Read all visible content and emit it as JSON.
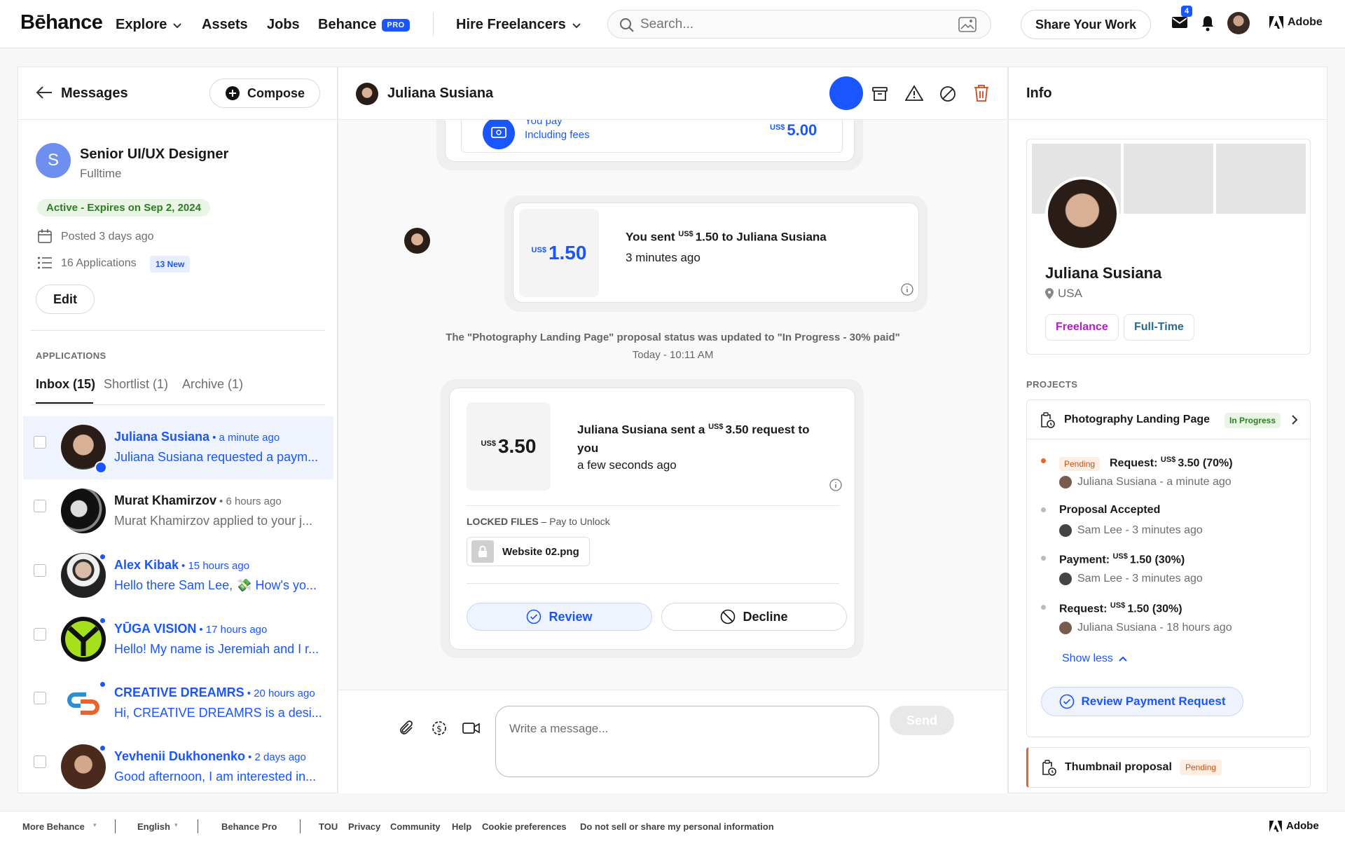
{
  "nav": {
    "logo": "Bēhance",
    "explore": "Explore",
    "assets": "Assets",
    "jobs": "Jobs",
    "behance": "Behance",
    "pro": "PRO",
    "hire": "Hire Freelancers",
    "search_placeholder": "Search...",
    "share": "Share Your Work",
    "mail_count": "4",
    "adobe": "Adobe"
  },
  "left": {
    "title": "Messages",
    "compose": "Compose",
    "job": {
      "initial": "S",
      "title": "Senior UI/UX Designer",
      "type": "Fulltime",
      "status": "Active - Expires on Sep 2, 2024",
      "posted": "Posted 3 days ago",
      "applications": "16 Applications",
      "new_badge": "13 New",
      "edit": "Edit"
    },
    "applications_label": "APPLICATIONS",
    "tabs": [
      "Inbox (15)",
      "Shortlist (1)",
      "Archive (1)"
    ],
    "conversations": [
      {
        "name": "Juliana Susiana",
        "time": "• a minute ago",
        "preview": "Juliana Susiana requested a paym...",
        "unread": true
      },
      {
        "name": "Murat Khamirzov",
        "time": "• 6 hours ago",
        "preview": "Murat Khamirzov applied to your j...",
        "unread": false
      },
      {
        "name": "Alex Kibak",
        "time": "• 15 hours ago",
        "preview": "Hello there Sam Lee, 💸 How's yo...",
        "unread": true
      },
      {
        "name": "YŪGA VISION",
        "time": "• 17 hours ago",
        "preview": "Hello! My name is Jeremiah and I r...",
        "unread": true
      },
      {
        "name": "CREATIVE DREAMRS",
        "time": "• 20 hours ago",
        "preview": "Hi, CREATIVE DREAMRS is a desi...",
        "unread": true
      },
      {
        "name": "Yevhenii Dukhonenko",
        "time": "• 2 days ago",
        "preview": "Good afternoon, I am interested in...",
        "unread": true
      }
    ]
  },
  "chat": {
    "name": "Juliana Susiana",
    "top_card": {
      "pay_label": "You pay",
      "fees": "Including fees",
      "currency": "US$",
      "amount": "5.00"
    },
    "sent_card": {
      "currency": "US$",
      "amount": "1.50",
      "line_pre": "You sent ",
      "line_amount": "1.50",
      "line_post": " to Juliana Susiana",
      "time": "3 minutes ago"
    },
    "status_msg": "The \"Photography Landing Page\" proposal status was updated to \"In Progress - 30% paid\"",
    "status_time": "Today - 10:11 AM",
    "request_card": {
      "currency": "US$",
      "amount": "3.50",
      "line_pre": "Juliana Susiana sent a ",
      "line_amount": "3.50",
      "line_post": " request to you",
      "time": "a few seconds ago",
      "locked_label": "LOCKED FILES",
      "locked_sub": " – Pay to Unlock",
      "file": "Website 02.png",
      "review": "Review",
      "decline": "Decline"
    },
    "input_placeholder": "Write a message...",
    "send": "Send"
  },
  "info": {
    "title": "Info",
    "name": "Juliana Susiana",
    "location": "USA",
    "tags": [
      "Freelance",
      "Full-Time"
    ],
    "projects_label": "PROJECTS",
    "project": {
      "title": "Photography Landing Page",
      "status": "In Progress"
    },
    "timeline": [
      {
        "badge": "Pending",
        "label": "Request:",
        "currency": "US$",
        "value": "3.50 (70%)",
        "who": "Juliana Susiana",
        "when": "- a minute ago"
      },
      {
        "badge": "",
        "label": "Proposal Accepted",
        "currency": "",
        "value": "",
        "who": "Sam Lee",
        "when": "- 3 minutes ago"
      },
      {
        "badge": "",
        "label": "Payment:",
        "currency": "US$",
        "value": "1.50 (30%)",
        "who": "Sam Lee",
        "when": "- 3 minutes ago"
      },
      {
        "badge": "",
        "label": "Request:",
        "currency": "US$",
        "value": "1.50 (30%)",
        "who": "Juliana Susiana",
        "when": "- 18 hours ago"
      }
    ],
    "show_less": "Show less",
    "review_payment": "Review Payment Request",
    "thumb_proposal": {
      "title": "Thumbnail proposal",
      "status": "Pending"
    }
  },
  "footer": {
    "more": "More Behance",
    "lang": "English",
    "pro": "Behance Pro",
    "links": [
      "TOU",
      "Privacy",
      "Community",
      "Help",
      "Cookie preferences",
      "Do not sell or share my personal information"
    ],
    "adobe": "Adobe"
  }
}
